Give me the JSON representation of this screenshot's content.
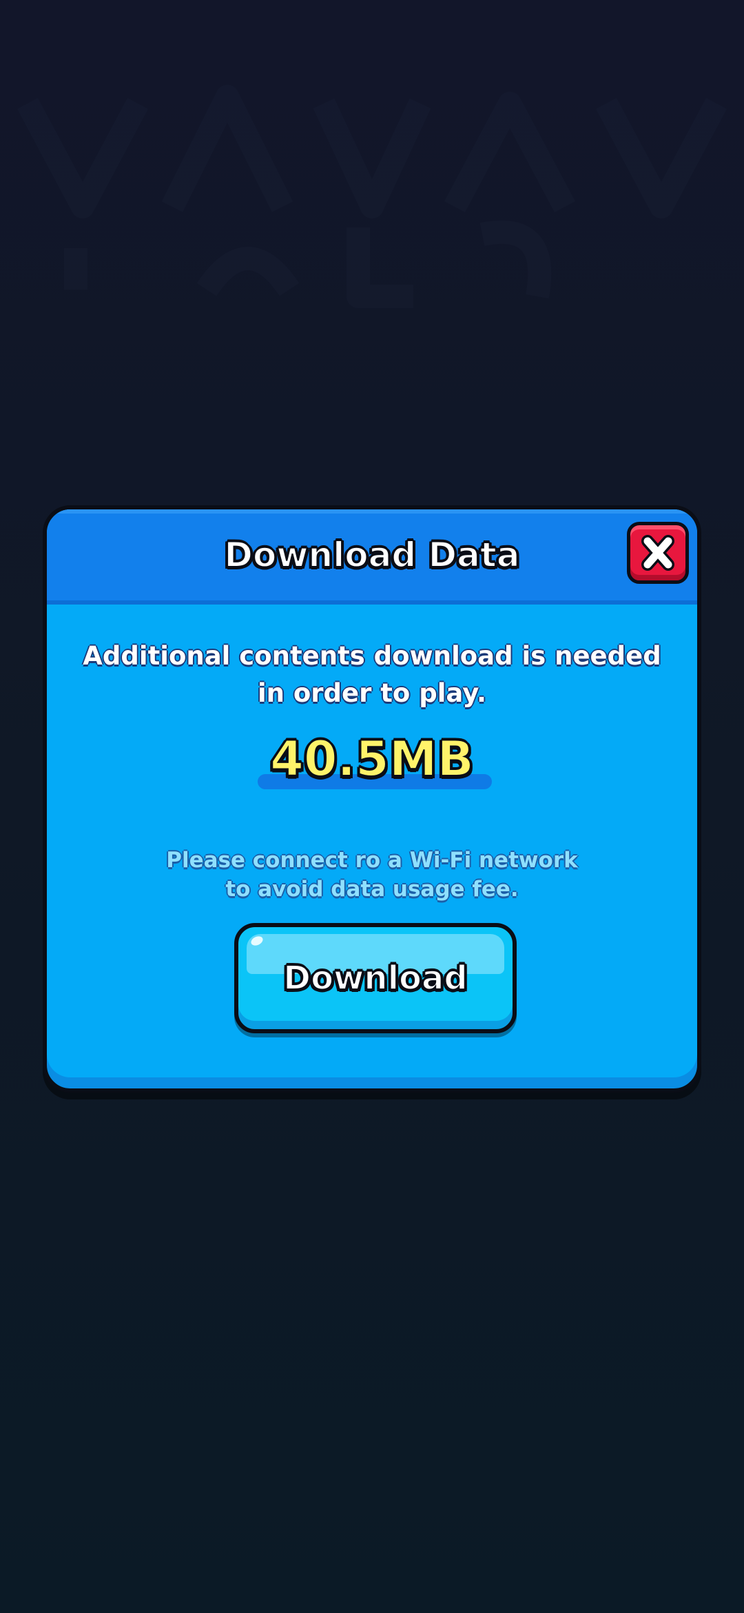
{
  "dialog": {
    "title": "Download Data",
    "close_icon": "close-x-icon",
    "message_line1": "Additional contents download is needed",
    "message_line2": "in order to play.",
    "download_size": "40.5MB",
    "wifi_note_line1": "Please connect ro a Wi-Fi network",
    "wifi_note_line2": "to avoid data usage fee.",
    "download_button_label": "Download"
  },
  "colors": {
    "panel": "#04aaf7",
    "header": "#1280ec",
    "close_button": "#e8173e",
    "size_text": "#fff36a",
    "download_button": "#0bc4f7",
    "background": "#12162a"
  }
}
